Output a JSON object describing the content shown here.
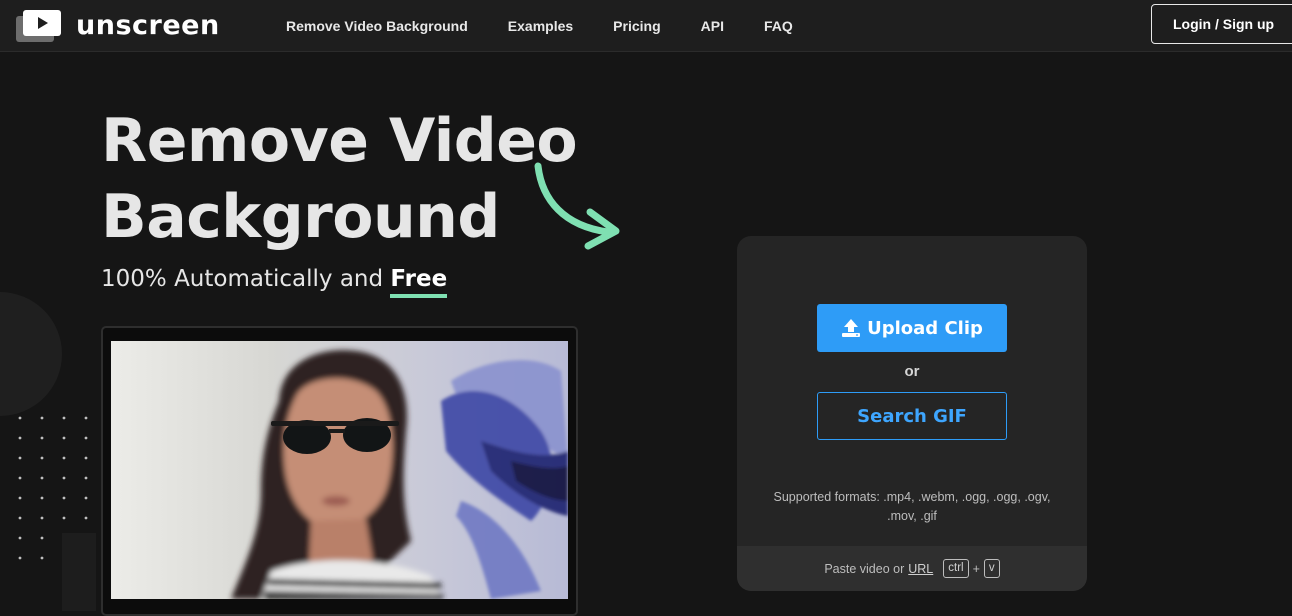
{
  "header": {
    "logo_text": "unscreen",
    "nav": [
      {
        "label": "Remove Video Background"
      },
      {
        "label": "Examples"
      },
      {
        "label": "Pricing"
      },
      {
        "label": "API"
      },
      {
        "label": "FAQ"
      }
    ],
    "login_label": "Login / Sign up"
  },
  "hero": {
    "title_line1": "Remove Video",
    "title_line2": "Background",
    "subtitle_prefix": "100% Automatically and ",
    "subtitle_highlight": "Free",
    "accent_color": "#7fe0b2"
  },
  "card": {
    "upload_label": "Upload Clip",
    "or_label": "or",
    "search_label": "Search GIF",
    "formats_text": "Supported formats: .mp4, .webm, .ogg, .ogg, .ogv, .mov, .gif",
    "paste_prefix": "Paste video or",
    "paste_url": "URL",
    "key_ctrl": "ctrl",
    "key_plus": "+",
    "key_v": "v",
    "button_color": "#2e9cf7"
  },
  "icons": {
    "logo": "video-play-icon",
    "upload": "upload-icon",
    "arrow": "curved-arrow-icon"
  }
}
